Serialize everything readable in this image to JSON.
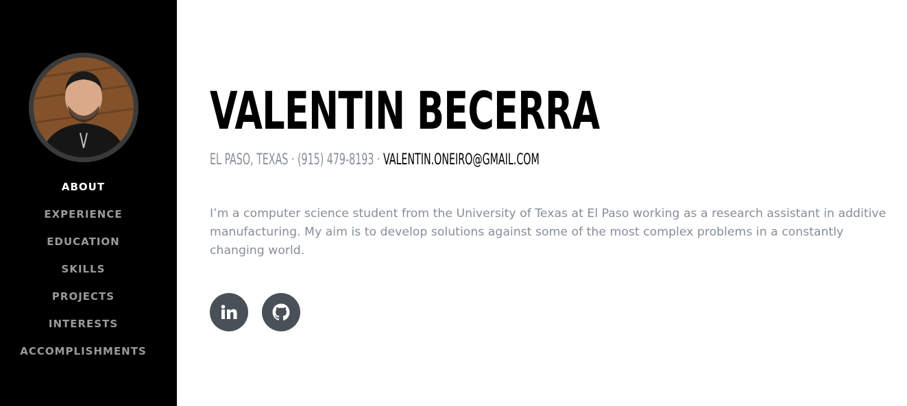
{
  "sidebar": {
    "nav": [
      {
        "label": "About",
        "active": true
      },
      {
        "label": "Experience",
        "active": false
      },
      {
        "label": "Education",
        "active": false
      },
      {
        "label": "Skills",
        "active": false
      },
      {
        "label": "Projects",
        "active": false
      },
      {
        "label": "Interests",
        "active": false
      },
      {
        "label": "Accomplishments",
        "active": false
      }
    ]
  },
  "about": {
    "name": "VALENTIN BECERRA",
    "location": "EL PASO, TEXAS",
    "separator": " · ",
    "phone": "(915) 479-8193",
    "email": "VALENTIN.ONEIRO@GMAIL.COM",
    "bio": "I’m a computer science student from the University of Texas at El Paso working as a research assistant in additive manufacturing. My aim is to develop solutions against some of the most complex problems in a constantly changing world."
  },
  "social": [
    {
      "name": "linkedin",
      "icon": "linkedin-icon"
    },
    {
      "name": "github",
      "icon": "github-icon"
    }
  ],
  "colors": {
    "sidebar_bg": "#000000",
    "nav_active": "#ffffff",
    "nav_inactive": "#9a9a9a",
    "muted_text": "#868e96",
    "social_bg": "#495057"
  }
}
